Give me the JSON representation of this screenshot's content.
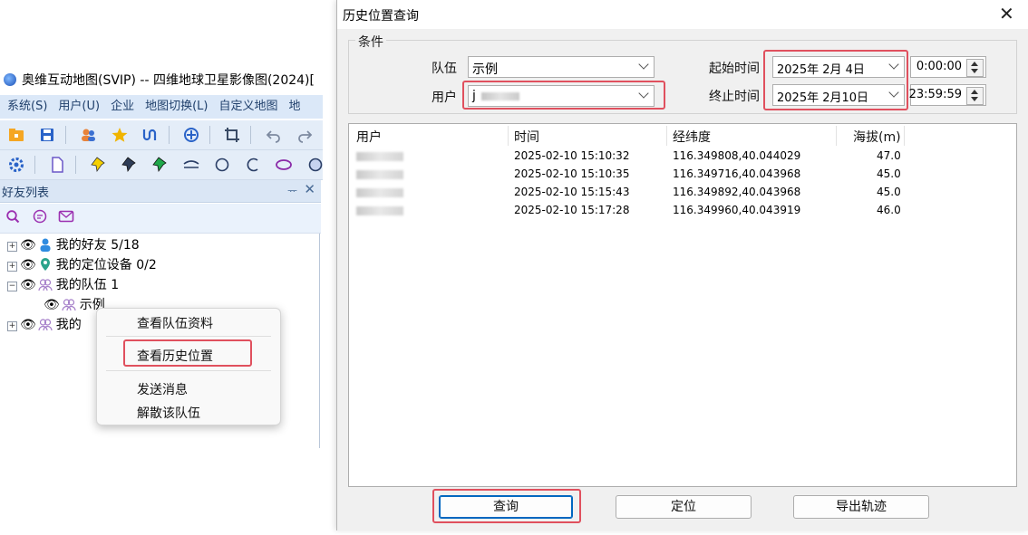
{
  "app": {
    "title": "奥维互动地图(SVIP) -- 四维地球卫星影像图(2024)[",
    "menu": [
      "系统(S)",
      "用户(U)",
      "企业",
      "地图切换(L)",
      "自定义地图",
      "地"
    ],
    "toolbar1_icons": [
      "open-folder-icon",
      "save-icon",
      "contacts-icon",
      "star-icon",
      "route-icon",
      "layers-icon",
      "crop-icon",
      "undo-icon",
      "redo-icon",
      "delete-icon"
    ],
    "toolbar2_icons": [
      "settings-icon",
      "document-icon",
      "yellow-pin-icon",
      "blue-pin-icon",
      "green-pin-icon",
      "curve-icon",
      "circle-icon",
      "arc-icon",
      "ellipse-icon",
      "filled-circle-icon",
      "rect-icon",
      "polygon-icon"
    ]
  },
  "friends_panel": {
    "title": "好友列表",
    "pin": "ᅲ",
    "close": "✕",
    "icons": [
      "search-icon",
      "chat-icon",
      "mail-icon"
    ],
    "tree": [
      {
        "label": "我的好友 5/18",
        "icon": "person-icon",
        "expander": "+"
      },
      {
        "label": "我的定位设备 0/2",
        "icon": "location-pin-icon",
        "expander": "+"
      },
      {
        "label": "我的队伍 1",
        "icon": "team-icon",
        "expander": "−"
      },
      {
        "label": "示例",
        "icon": "team-icon",
        "expander": ""
      },
      {
        "label": "我的",
        "icon": "team-icon",
        "expander": "+"
      }
    ]
  },
  "context_menu": {
    "items": [
      "查看队伍资料",
      "查看历史位置",
      "发送消息",
      "解散该队伍"
    ]
  },
  "dialog": {
    "title": "历史位置查询",
    "close": "✕",
    "group_title": "条件",
    "team_label": "队伍",
    "team_value": "示例",
    "user_label": "用户",
    "user_value": "j",
    "start_label": "起始时间",
    "start_date": "2025年  2月  4日",
    "start_time": "0:00:00",
    "end_label": "终止时间",
    "end_date": "2025年  2月10日",
    "end_time": "23:59:59",
    "columns": [
      "用户",
      "时间",
      "经纬度",
      "海拔(m)"
    ],
    "rows": [
      {
        "time": "2025-02-10 15:10:32",
        "latlng": "116.349808,40.044029",
        "alt": "47.0"
      },
      {
        "time": "2025-02-10 15:10:35",
        "latlng": "116.349716,40.043968",
        "alt": "45.0"
      },
      {
        "time": "2025-02-10 15:15:43",
        "latlng": "116.349892,40.043968",
        "alt": "45.0"
      },
      {
        "time": "2025-02-10 15:17:28",
        "latlng": "116.349960,40.043919",
        "alt": "46.0"
      }
    ],
    "buttons": {
      "query": "查询",
      "locate": "定位",
      "export": "导出轨迹"
    }
  }
}
